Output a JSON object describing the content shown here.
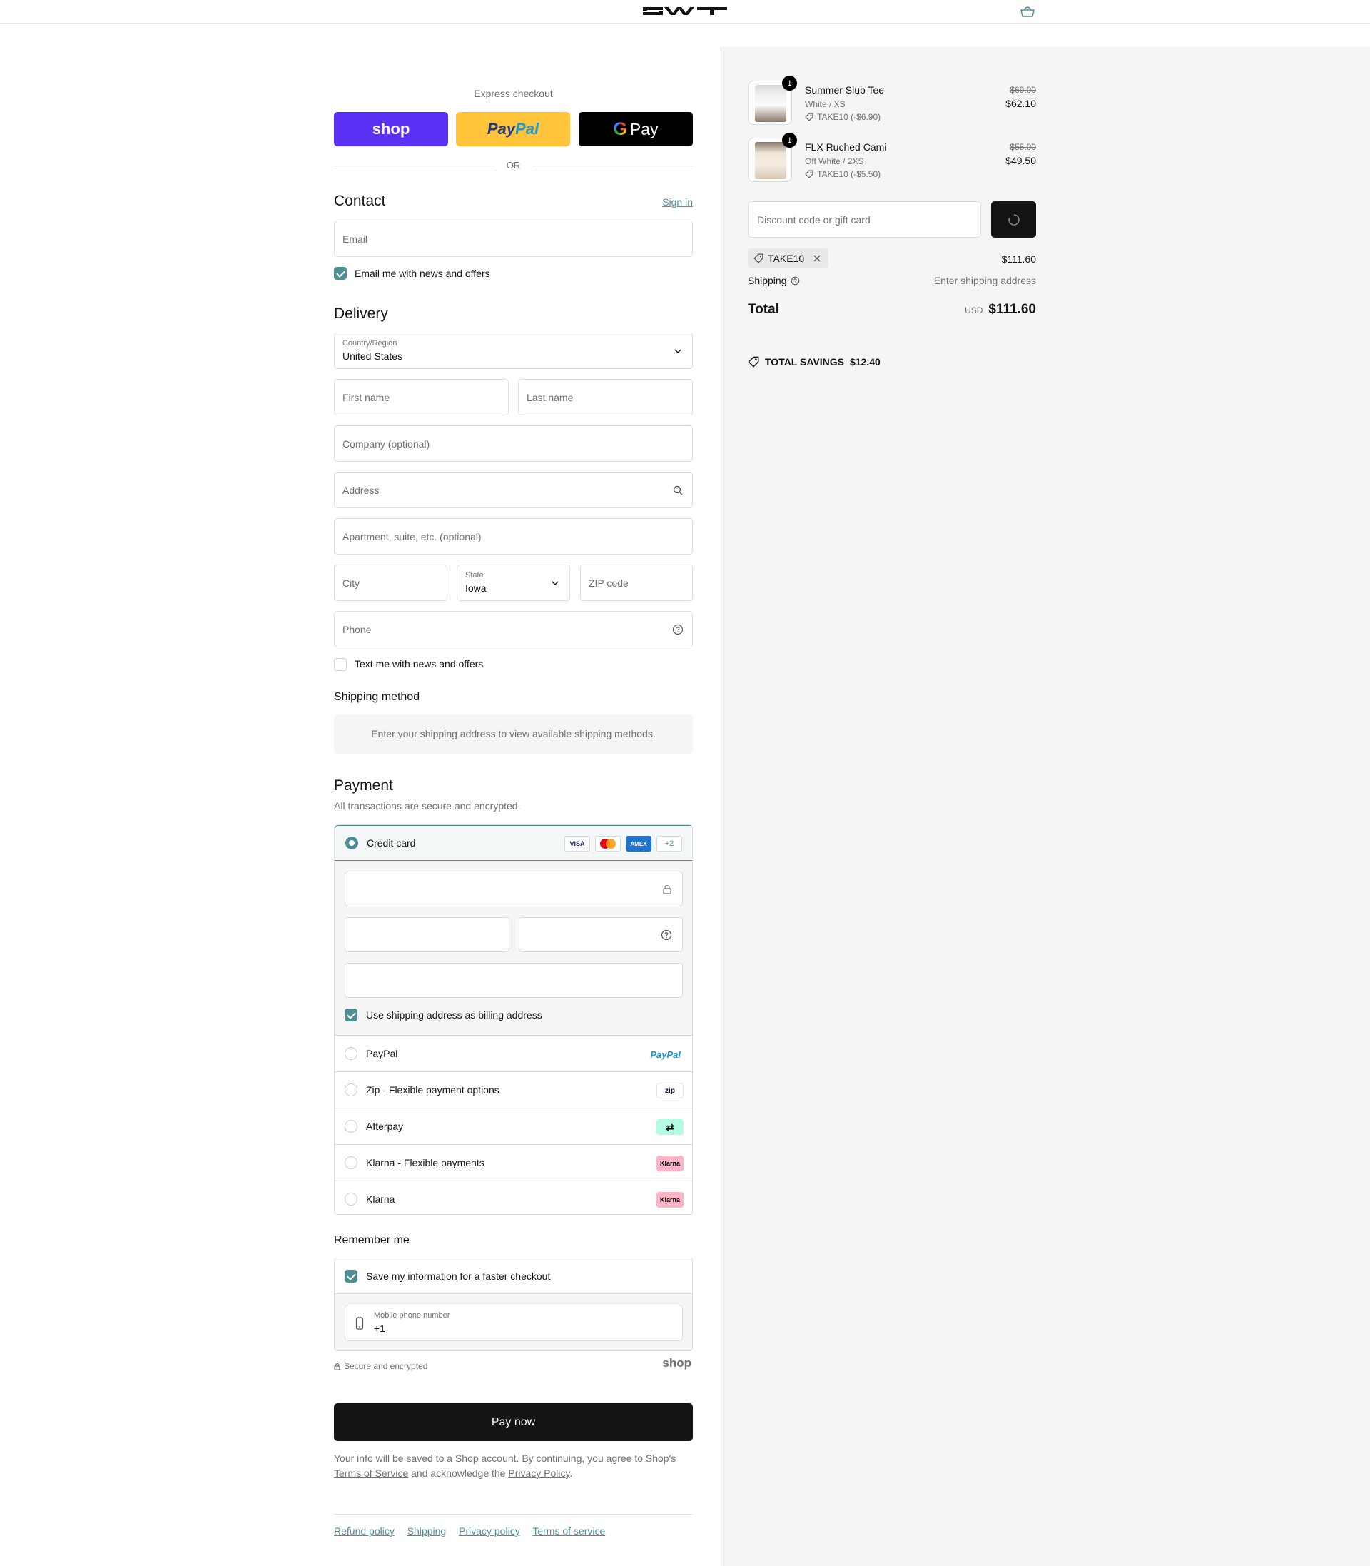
{
  "header": {
    "logo_text": "SWT",
    "cart_icon": "bag-icon"
  },
  "express": {
    "title": "Express checkout",
    "shop_label": "shop",
    "paypal_label_1": "Pay",
    "paypal_label_2": "Pal",
    "gpay_g": "G",
    "gpay_label": "Pay",
    "or_label": "OR"
  },
  "contact": {
    "title": "Contact",
    "sign_in": "Sign in",
    "email_placeholder": "Email",
    "news_label": "Email me with news and offers",
    "news_checked": true
  },
  "delivery": {
    "title": "Delivery",
    "country_label": "Country/Region",
    "country_value": "United States",
    "first_name_placeholder": "First name",
    "last_name_placeholder": "Last name",
    "company_placeholder": "Company (optional)",
    "address_placeholder": "Address",
    "apartment_placeholder": "Apartment, suite, etc. (optional)",
    "city_placeholder": "City",
    "state_label": "State",
    "state_value": "Iowa",
    "zip_placeholder": "ZIP code",
    "phone_placeholder": "Phone",
    "text_label": "Text me with news and offers",
    "text_checked": false
  },
  "shipping_method": {
    "title": "Shipping method",
    "message": "Enter your shipping address to view available shipping methods."
  },
  "payment": {
    "title": "Payment",
    "subtitle": "All transactions are secure and encrypted.",
    "credit_card_label": "Credit card",
    "card_brands": [
      "VISA",
      "MC",
      "AMEX",
      "+2"
    ],
    "billing_label": "Use shipping address as billing address",
    "billing_checked": true,
    "options": [
      {
        "label": "PayPal",
        "logo": "PayPal"
      },
      {
        "label": "Zip - Flexible payment options",
        "logo": "zip"
      },
      {
        "label": "Afterpay",
        "logo": "afterpay"
      },
      {
        "label": "Klarna - Flexible payments",
        "logo": "Klarna"
      },
      {
        "label": "Klarna",
        "logo": "Klarna"
      }
    ]
  },
  "remember": {
    "title": "Remember me",
    "save_label": "Save my information for a faster checkout",
    "save_checked": true,
    "mobile_label": "Mobile phone number",
    "mobile_value": "+1",
    "secure_label": "Secure and encrypted",
    "shop_brand": "shop"
  },
  "pay_now": "Pay now",
  "disclaimer": {
    "text_1": "Your info will be saved to a Shop account. By continuing, you agree to Shop's",
    "terms": "Terms of Service",
    "text_2": "and acknowledge the",
    "privacy": "Privacy Policy",
    "text_3": "."
  },
  "footer_links": [
    "Refund policy",
    "Shipping",
    "Privacy policy",
    "Terms of service"
  ],
  "summary": {
    "items": [
      {
        "name": "Summer Slub Tee",
        "variant": "White / XS",
        "discount": "TAKE10 (-$6.90)",
        "price_old": "$69.00",
        "price_new": "$62.10",
        "qty": "1"
      },
      {
        "name": "FLX Ruched Cami",
        "variant": "Off White / 2XS",
        "discount": "TAKE10 (-$5.50)",
        "price_old": "$55.00",
        "price_new": "$49.50",
        "qty": "1"
      }
    ],
    "discount_placeholder": "Discount code or gift card",
    "applied_code": "TAKE10",
    "subtotal_value": "$111.60",
    "shipping_label": "Shipping",
    "shipping_value": "Enter shipping address",
    "total_label": "Total",
    "total_currency": "USD",
    "total_value": "$111.60",
    "savings_label": "TOTAL SAVINGS",
    "savings_value": "$12.40"
  },
  "colors": {
    "accent": "#4e8f93",
    "shop_purple": "#5a31f4",
    "paypal_yellow": "#ffc439",
    "dark": "#141414"
  }
}
